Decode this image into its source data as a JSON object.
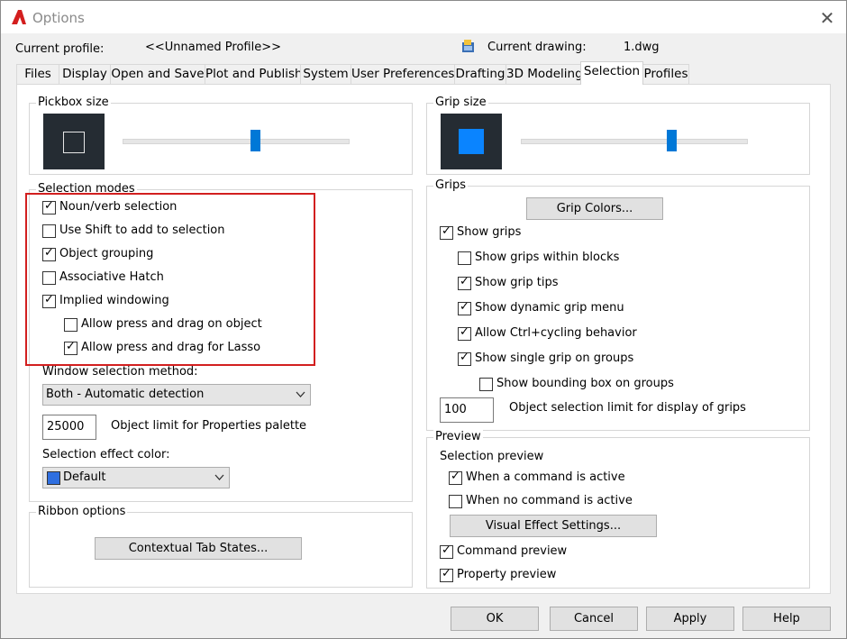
{
  "window": {
    "title": "Options",
    "close_glyph": "✕"
  },
  "header": {
    "profile_label": "Current profile:",
    "profile_value": "<<Unnamed Profile>>",
    "drawing_label": "Current drawing:",
    "drawing_value": "1.dwg"
  },
  "tabs": [
    {
      "label": "Files"
    },
    {
      "label": "Display"
    },
    {
      "label": "Open and Save"
    },
    {
      "label": "Plot and Publish"
    },
    {
      "label": "System"
    },
    {
      "label": "User Preferences"
    },
    {
      "label": "Drafting"
    },
    {
      "label": "3D Modeling"
    },
    {
      "label": "Selection",
      "active": true
    },
    {
      "label": "Profiles"
    }
  ],
  "pickbox": {
    "title": "Pickbox size",
    "slider_value": 0.59
  },
  "grip_size": {
    "title": "Grip size",
    "slider_value": 0.67
  },
  "selection_modes": {
    "title": "Selection modes",
    "options": [
      {
        "label": "Noun/verb selection",
        "checked": true
      },
      {
        "label": "Use Shift to add to selection",
        "checked": false
      },
      {
        "label": "Object grouping",
        "checked": true
      },
      {
        "label": "Associative Hatch",
        "checked": false
      },
      {
        "label": "Implied windowing",
        "checked": true
      },
      {
        "label": "Allow press and drag on object",
        "checked": false
      },
      {
        "label": "Allow press and drag for Lasso",
        "checked": true
      }
    ],
    "window_method_label": "Window selection method:",
    "window_method_value": "Both - Automatic detection",
    "object_limit_value": "25000",
    "object_limit_label": "Object limit for Properties palette",
    "effect_color_label": "Selection effect color:",
    "effect_color_value": "Default",
    "effect_color_swatch": "#2f6fe0"
  },
  "ribbon": {
    "title": "Ribbon options",
    "button": "Contextual Tab States..."
  },
  "grips": {
    "title": "Grips",
    "colors_button": "Grip Colors...",
    "options": [
      {
        "label": "Show grips",
        "checked": true
      },
      {
        "label": "Show grips within blocks",
        "checked": false
      },
      {
        "label": "Show grip tips",
        "checked": true
      },
      {
        "label": "Show dynamic grip menu",
        "checked": true
      },
      {
        "label": "Allow Ctrl+cycling behavior",
        "checked": true
      },
      {
        "label": "Show single grip on groups",
        "checked": true
      },
      {
        "label": "Show bounding box on groups",
        "checked": false
      }
    ],
    "limit_value": "100",
    "limit_label": "Object selection limit for display of grips"
  },
  "preview": {
    "title": "Preview",
    "subtitle": "Selection preview",
    "options": [
      {
        "label": "When a command is active",
        "checked": true
      },
      {
        "label": "When no command is active",
        "checked": false
      }
    ],
    "visual_button": "Visual Effect Settings...",
    "bottom_options": [
      {
        "label": "Command preview",
        "checked": true
      },
      {
        "label": "Property preview",
        "checked": true
      }
    ]
  },
  "footer": {
    "ok": "OK",
    "cancel": "Cancel",
    "apply": "Apply",
    "help": "Help"
  },
  "colors": {
    "accent": "#0078d7",
    "highlight_outline": "#d21f1f",
    "preview_bg": "#252c33",
    "grip_fill": "#0a84ff"
  }
}
